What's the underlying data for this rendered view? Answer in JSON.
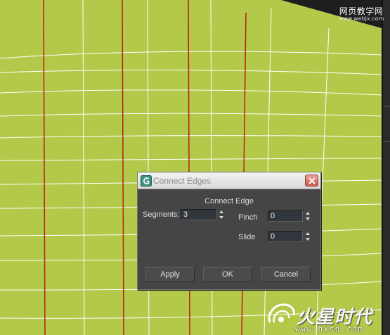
{
  "viewport": {
    "background": "#1e1e1e",
    "floor_color": "#b3c94a",
    "grid_line_color": "#ffffff",
    "selected_edge_color": "#c01e14"
  },
  "watermarks": {
    "top_site_name": "网页教学网",
    "top_site_url": "www.webjx.com",
    "bottom_brand": "火星时代",
    "bottom_url": "www.hxsd.com"
  },
  "dialog": {
    "title": "Connect Edges",
    "heading": "Connect Edge",
    "segments_label": "Segments:",
    "segments_value": "3",
    "pinch_label": "Pinch",
    "pinch_value": "0",
    "slide_label": "Slide",
    "slide_value": "0",
    "apply_label": "Apply",
    "ok_label": "OK",
    "cancel_label": "Cancel",
    "accent": "#4a9e8c",
    "close_color": "#c9564b"
  }
}
